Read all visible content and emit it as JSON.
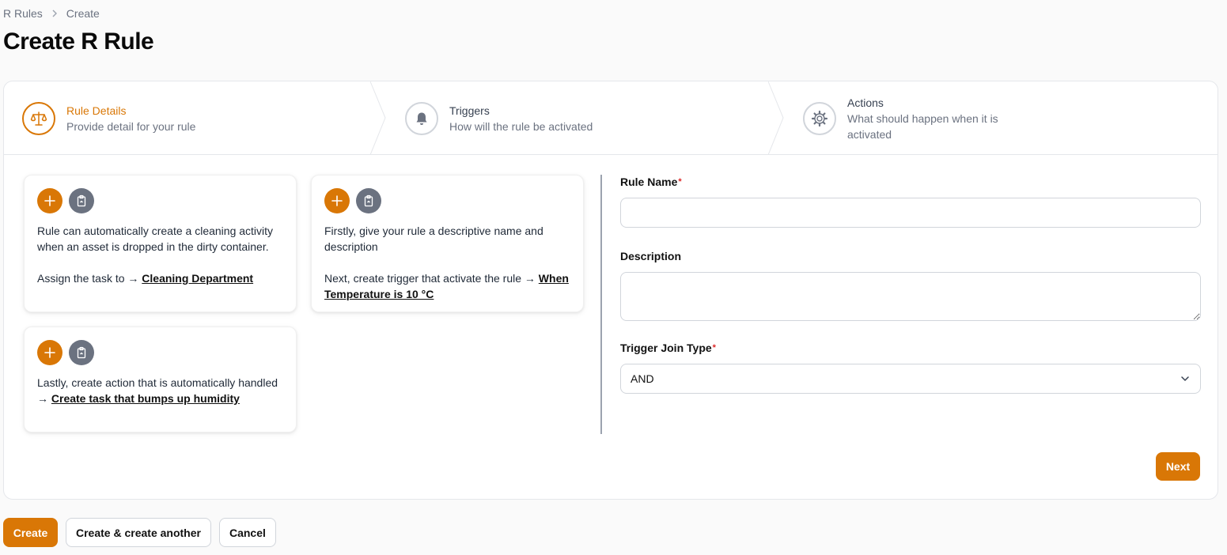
{
  "breadcrumb": {
    "parent": "R Rules",
    "current": "Create"
  },
  "page_title": "Create R Rule",
  "stepper": {
    "steps": [
      {
        "title": "Rule Details",
        "subtitle": "Provide detail for your rule",
        "icon": "scale-icon",
        "active": true
      },
      {
        "title": "Triggers",
        "subtitle": "How will the rule be activated",
        "icon": "bell-icon",
        "active": false
      },
      {
        "title": "Actions",
        "subtitle": "What should happen when it is activated",
        "icon": "gear-icon",
        "active": false
      }
    ]
  },
  "tips": [
    {
      "line1": "Rule can automatically create a cleaning activity when an asset is dropped in the dirty container.",
      "line2_prefix": "Assign the task to → ",
      "line2_link": "Cleaning Department"
    },
    {
      "line1": "Firstly, give your rule a descriptive name and description",
      "line2_prefix": "Next, create trigger that activate the rule → ",
      "line2_link": "When Temperature is 10 °C"
    },
    {
      "line1_prefix": "Lastly, create action that is automatically handled → ",
      "line1_link": "Create task that bumps up humidity"
    }
  ],
  "form": {
    "rule_name": {
      "label": "Rule Name",
      "required_mark": "*",
      "value": ""
    },
    "description": {
      "label": "Description",
      "value": ""
    },
    "trigger_join_type": {
      "label": "Trigger Join Type",
      "required_mark": "*",
      "value": "AND"
    }
  },
  "next_label": "Next",
  "footer": {
    "create_label": "Create",
    "create_another_label": "Create & create another",
    "cancel_label": "Cancel"
  },
  "colors": {
    "accent": "#d97706",
    "muted": "#6b7280",
    "border": "#e5e7eb"
  }
}
